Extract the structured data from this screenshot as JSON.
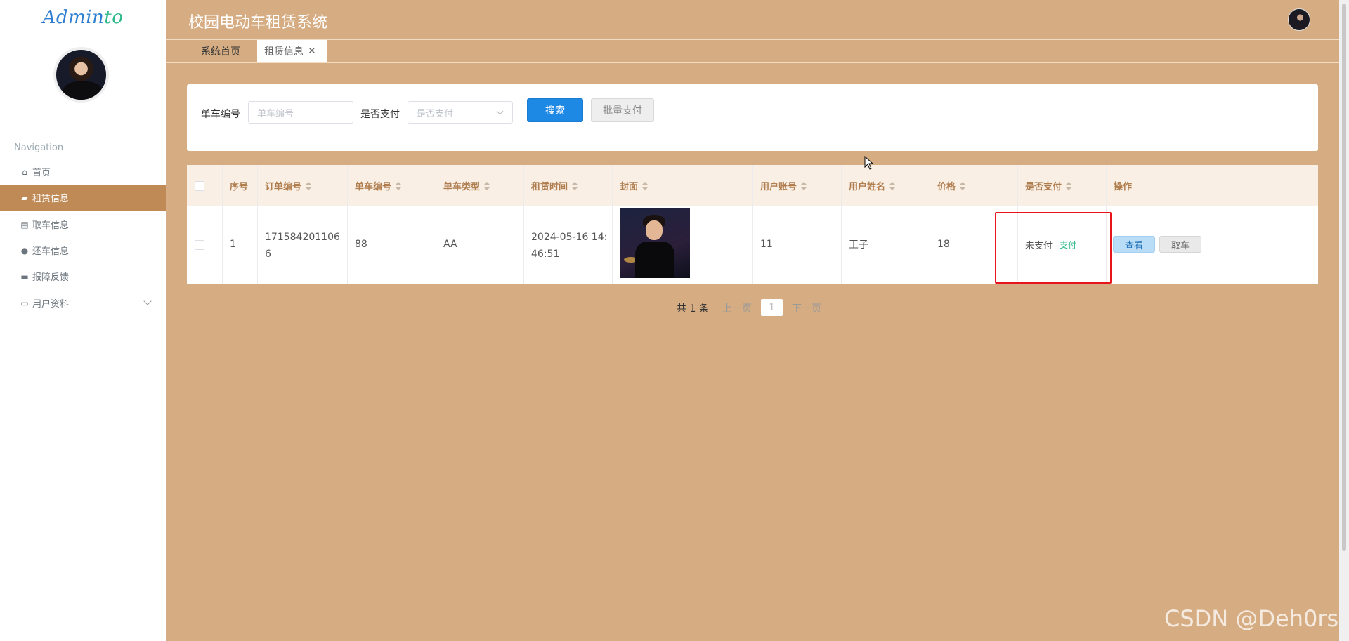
{
  "app": {
    "logo_main": "Admin",
    "logo_accent": "to",
    "title": "校园电动车租赁系统"
  },
  "sidebar": {
    "nav_title": "Navigation",
    "items": [
      {
        "label": "首页",
        "icon": "home-icon"
      },
      {
        "label": "租赁信息",
        "icon": "briefcase-icon"
      },
      {
        "label": "取车信息",
        "icon": "clipboard-icon"
      },
      {
        "label": "还车信息",
        "icon": "location-pin-icon"
      },
      {
        "label": "报障反馈",
        "icon": "monitor-icon"
      },
      {
        "label": "用户资料",
        "icon": "id-card-icon"
      }
    ],
    "active_index": 1
  },
  "tabs": [
    {
      "label": "系统首页"
    },
    {
      "label": "租赁信息"
    }
  ],
  "search": {
    "bike_no_label": "单车编号",
    "bike_no_placeholder": "单车编号",
    "paid_label": "是否支付",
    "paid_placeholder": "是否支付",
    "search_button": "搜索",
    "batch_pay_button": "批量支付"
  },
  "table": {
    "columns": [
      "序号",
      "订单编号",
      "单车编号",
      "单车类型",
      "租赁时间",
      "封面",
      "用户账号",
      "用户姓名",
      "价格",
      "是否支付",
      "操作"
    ],
    "rows": [
      {
        "index": "1",
        "order_no_line1": "171584201106",
        "order_no_line2": "6",
        "bike_no": "88",
        "bike_type": "AA",
        "rent_time_line1": "2024-05-16 14:",
        "rent_time_line2": "46:51",
        "user_account": "11",
        "user_name": "王子",
        "price": "18",
        "paid_status": "未支付",
        "pay_link": "支付",
        "view_button": "查看",
        "take_button": "取车"
      }
    ]
  },
  "pagination": {
    "total": "共 1 条",
    "prev": "上一页",
    "page": "1",
    "next": "下一页"
  },
  "watermark": "CSDN @Deh0rs",
  "colors": {
    "background": "#d6ac82",
    "active_nav": "#bf8a55",
    "primary": "#1e88e5",
    "highlight_box": "#e8141b"
  }
}
